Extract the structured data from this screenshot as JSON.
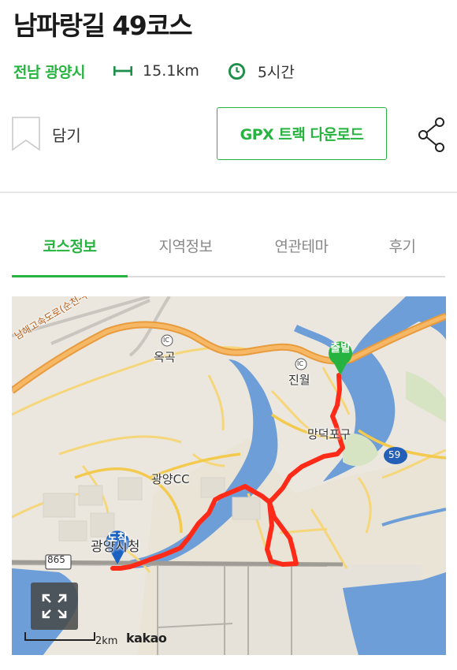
{
  "title": "남파랑길 49코스",
  "meta": {
    "region": "전남 광양시",
    "distance": "15.1km",
    "duration": "5시간"
  },
  "actions": {
    "bookmark_label": "담기",
    "gpx_label": "GPX 트랙 다운로드"
  },
  "tabs": [
    {
      "label": "코스정보",
      "active": true
    },
    {
      "label": "지역정보",
      "active": false
    },
    {
      "label": "연관테마",
      "active": false
    },
    {
      "label": "후기",
      "active": false
    }
  ],
  "map": {
    "labels": {
      "okgok": "옥곡",
      "jinwol": "진월",
      "mangdeok": "망덕포구",
      "gwangyang_cc": "광양CC",
      "city_hall": "광양시청",
      "road_865": "865",
      "road_59": "59",
      "ic1": "IC",
      "ic2": "IC",
      "highway": "남해고속도로(순천-부산)"
    },
    "start_marker": "출발",
    "end_marker": "도착",
    "scale": "2km",
    "provider": "kakao"
  },
  "colors": {
    "accent": "#27b33f",
    "route": "#ff2a17",
    "water": "#6d9ed8",
    "highway": "#f0a14a"
  }
}
